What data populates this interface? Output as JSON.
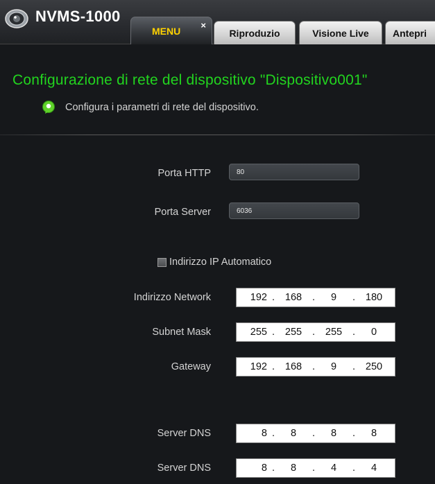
{
  "app": {
    "title": "NVMS-1000",
    "icon": "camera-lens-icon"
  },
  "tabs": [
    {
      "label": "MENU",
      "active": true,
      "close": "×"
    },
    {
      "label": "Riproduzio",
      "active": false
    },
    {
      "label": "Visione Live",
      "active": false
    },
    {
      "label": "Antepri",
      "active": false
    }
  ],
  "header": {
    "title": "Configurazione di rete del dispositivo \"Dispositivo001\"",
    "subtitle": "Configura i parametri di rete del dispositivo.",
    "title_color": "#22d41f",
    "info_icon": "info-bubble-icon"
  },
  "form": {
    "http_port": {
      "label": "Porta HTTP",
      "value": "80"
    },
    "server_port": {
      "label": "Porta Server",
      "value": "6036"
    },
    "auto_ip": {
      "label": "Indirizzo IP Automatico",
      "checked": false
    },
    "network_address": {
      "label": "Indirizzo Network",
      "octets": [
        "192",
        "168",
        "9",
        "180"
      ]
    },
    "subnet_mask": {
      "label": "Subnet Mask",
      "octets": [
        "255",
        "255",
        "255",
        "0"
      ]
    },
    "gateway": {
      "label": "Gateway",
      "octets": [
        "192",
        "168",
        "9",
        "250"
      ]
    },
    "dns_primary": {
      "label": "Server DNS",
      "octets": [
        "8",
        "8",
        "8",
        "8"
      ]
    },
    "dns_secondary": {
      "label": "Server DNS",
      "octets": [
        "8",
        "8",
        "4",
        "4"
      ]
    }
  },
  "ip_separator": "."
}
